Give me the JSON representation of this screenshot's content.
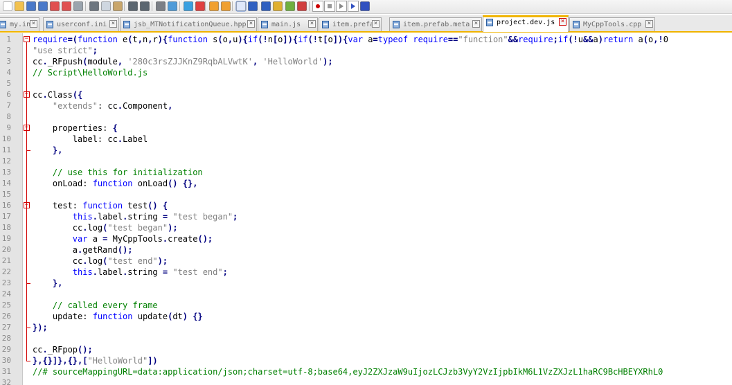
{
  "toolbar": {
    "buttons": [
      "new-file-icon",
      "open-file-icon",
      "save-icon",
      "save-all-icon",
      "close-icon",
      "close-all-icon",
      "print-icon",
      "cut-icon",
      "copy-icon",
      "paste-icon",
      "undo-icon",
      "redo-icon",
      "find-icon",
      "replace-icon",
      "zoom-in-icon",
      "zoom-out-icon",
      "sync-vertical-icon",
      "sync-horizontal-icon",
      "word-wrap-icon",
      "show-all-characters-icon",
      "indent-guide-icon",
      "user-language-icon",
      "doc-map-icon",
      "function-list-icon",
      "record-macro-icon",
      "stop-recording-icon",
      "play-macro-icon",
      "run-macro-multiple-icon",
      "save-macro-icon"
    ]
  },
  "tabs": [
    {
      "label": "my.ini",
      "active": false
    },
    {
      "label": "userconf.ini",
      "active": false
    },
    {
      "label": "jsb_MTNotificationQueue.hpp",
      "active": false
    },
    {
      "label": "main.js",
      "active": false
    },
    {
      "label": "item.prefab",
      "active": false
    },
    {
      "label": "item.prefab.meta",
      "active": false
    },
    {
      "label": "project.dev.js",
      "active": true
    },
    {
      "label": "MyCppTools.cpp",
      "active": false
    }
  ],
  "editor": {
    "lines": [
      {
        "n": "1",
        "t": "require=(function e(t,n,r){function s(o,u){if(!n[o]){if(!t[o]){var a=typeof require==\"function\"&&require;if(!u&&a)return a(o,!0"
      },
      {
        "n": "2",
        "t": "\"use strict\";"
      },
      {
        "n": "3",
        "t": "cc._RFpush(module, '280c3rsZJJKnZ9RqbALVwtK', 'HelloWorld');"
      },
      {
        "n": "4",
        "t": "// Script\\HelloWorld.js"
      },
      {
        "n": "5",
        "t": ""
      },
      {
        "n": "6",
        "t": "cc.Class({"
      },
      {
        "n": "7",
        "t": "    \"extends\": cc.Component,"
      },
      {
        "n": "8",
        "t": ""
      },
      {
        "n": "9",
        "t": "    properties: {"
      },
      {
        "n": "10",
        "t": "        label: cc.Label"
      },
      {
        "n": "11",
        "t": "    },"
      },
      {
        "n": "12",
        "t": ""
      },
      {
        "n": "13",
        "t": "    // use this for initialization"
      },
      {
        "n": "14",
        "t": "    onLoad: function onLoad() {},"
      },
      {
        "n": "15",
        "t": ""
      },
      {
        "n": "16",
        "t": "    test: function test() {"
      },
      {
        "n": "17",
        "t": "        this.label.string = \"test began\";"
      },
      {
        "n": "18",
        "t": "        cc.log(\"test began\");"
      },
      {
        "n": "19",
        "t": "        var a = MyCppTools.create();"
      },
      {
        "n": "20",
        "t": "        a.getRand();"
      },
      {
        "n": "21",
        "t": "        cc.log(\"test end\");"
      },
      {
        "n": "22",
        "t": "        this.label.string = \"test end\";"
      },
      {
        "n": "23",
        "t": "    },"
      },
      {
        "n": "24",
        "t": ""
      },
      {
        "n": "25",
        "t": "    // called every frame"
      },
      {
        "n": "26",
        "t": "    update: function update(dt) {}"
      },
      {
        "n": "27",
        "t": "});"
      },
      {
        "n": "28",
        "t": ""
      },
      {
        "n": "29",
        "t": "cc._RFpop();"
      },
      {
        "n": "30",
        "t": "},{}]},{},[\"HelloWorld\"])"
      },
      {
        "n": "31",
        "t": "//# sourceMappingURL=data:application/json;charset=utf-8;base64,eyJ2ZXJzaW9uIjozLCJzb3VyY2VzIjpbIkM6L1VzZXJzL1haRC9BcHBEYXRhL0"
      },
      {
        "n": "32",
        "t": ""
      }
    ]
  }
}
